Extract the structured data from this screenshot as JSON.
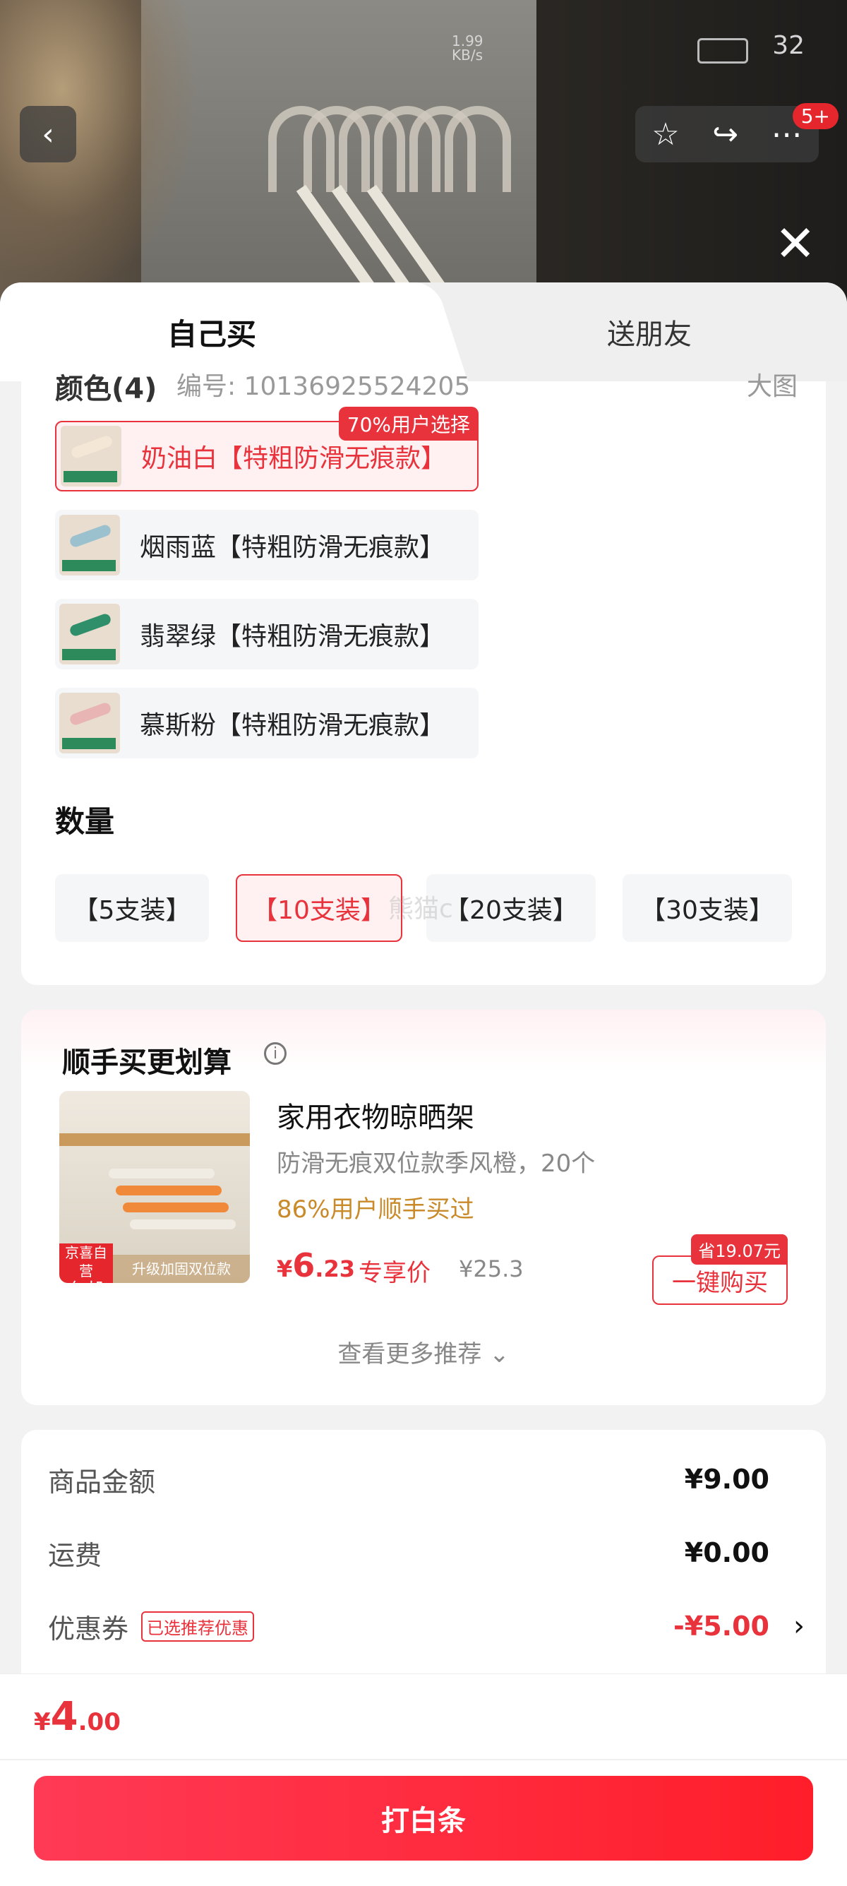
{
  "status_bar": {
    "net_speed": "1.99 KB/s",
    "battery": "32"
  },
  "header": {
    "badge": "5+"
  },
  "tabs": {
    "self_buy": "自己买",
    "gift": "送朋友"
  },
  "spec": {
    "cut_label": "颜色(4)",
    "cut_code": "编号: 10136925524205",
    "cut_view": "大图",
    "options": [
      {
        "label": "奶油白【特粗防滑无痕款】",
        "badge": "70%用户选择",
        "selected": true,
        "color": "#f4e7d6"
      },
      {
        "label": "烟雨蓝【特粗防滑无痕款】",
        "selected": false,
        "color": "#9bc1cf"
      },
      {
        "label": "翡翠绿【特粗防滑无痕款】",
        "selected": false,
        "color": "#2f8f6a"
      },
      {
        "label": "慕斯粉【特粗防滑无痕款】",
        "selected": false,
        "color": "#e8b4b4"
      }
    ],
    "quantity_title": "数量",
    "quantities": [
      "【5支装】",
      "【10支装】",
      "【20支装】",
      "【30支装】"
    ],
    "selected_quantity": "【10支装】",
    "watermark": "熊猫c"
  },
  "recommend": {
    "title": "顺手买更划算",
    "product_name": "家用衣物晾晒架",
    "product_desc": "防滑无痕双位款季风橙，20个",
    "social_proof": "86%用户顺手买过",
    "price_symbol": "¥",
    "price_int": "6",
    "price_dec": ".23",
    "price_label": "专享价",
    "original_price": "¥25.3",
    "save_badge": "省19.07元",
    "buy_button": "一键购买",
    "self_tag_1": "京喜自营",
    "self_tag_2": "包邮",
    "upgrade_tag": "升级加固双位款",
    "more": "查看更多推荐 ⌄"
  },
  "price_detail": {
    "rows": [
      {
        "label": "商品金额",
        "value": "¥9.00"
      },
      {
        "label": "运费",
        "value": "¥0.00"
      },
      {
        "label": "优惠券",
        "tag": "已选推荐优惠",
        "value": "-¥5.00"
      }
    ]
  },
  "bottom": {
    "total_symbol": "¥",
    "total_int": "4",
    "total_dec": ".00",
    "pay_button": "打白条"
  },
  "colors": {
    "accent": "#e8323c",
    "social": "#c98a2a"
  }
}
